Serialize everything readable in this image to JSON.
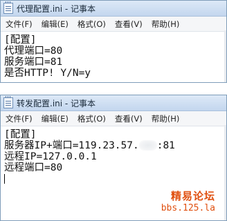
{
  "window1": {
    "title": "代理配置.ini - 记事本",
    "menu": [
      "文件(F)",
      "编辑(E)",
      "格式(O)",
      "查看(V)",
      "帮助(H)"
    ],
    "lines": [
      "[配置]",
      "代理端口=80",
      "服务端口=81",
      "是否HTTP! Y/N=y"
    ]
  },
  "window2": {
    "title": "转发配置.ini - 记事本",
    "menu": [
      "文件(F)",
      "编辑(E)",
      "格式(O)",
      "查看(V)",
      "帮助(H)"
    ],
    "lines": {
      "section": "[配置]",
      "server_prefix": "服务器IP+端口=119.23.57.",
      "server_suffix": ":81",
      "remote_ip": "远程IP=127.0.0.1",
      "remote_port": "远程端口=80"
    }
  },
  "watermark": {
    "cn": "精易论坛",
    "url": "bbs.125.la"
  }
}
